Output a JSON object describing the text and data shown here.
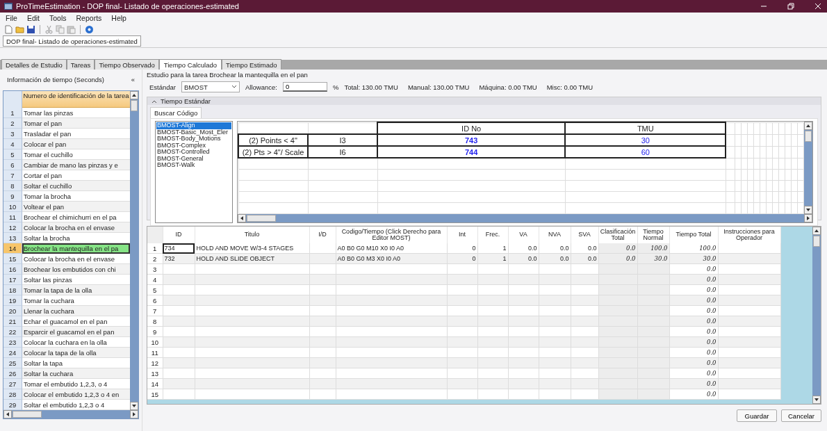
{
  "window": {
    "title": "ProTimeEstimation - DOP final- Listado de operaciones-estimated"
  },
  "menu": [
    "File",
    "Edit",
    "Tools",
    "Reports",
    "Help"
  ],
  "document_tab": {
    "label": "DOP final- Listado de operaciones-estimated",
    "selected": true
  },
  "tabs": [
    {
      "label": "Detalles de Estudio",
      "selected": false
    },
    {
      "label": "Tareas",
      "selected": false
    },
    {
      "label": "Tiempo Observado",
      "selected": false
    },
    {
      "label": "Tiempo Calculado",
      "selected": true
    },
    {
      "label": "Tiempo Estimado",
      "selected": false
    }
  ],
  "left_panel": {
    "title": "Información de tiempo (Seconds)",
    "collapse": "«",
    "header": "Numero de identificación de la tarea",
    "rows": [
      {
        "number": "1",
        "text": "Tomar las pinzas",
        "selected": false
      },
      {
        "number": "2",
        "text": "Tomar el pan",
        "selected": false
      },
      {
        "number": "3",
        "text": "Trasladar el pan",
        "selected": false
      },
      {
        "number": "4",
        "text": "Colocar el pan",
        "selected": false
      },
      {
        "number": "5",
        "text": "Tomar el cuchillo",
        "selected": false
      },
      {
        "number": "6",
        "text": "Cambiar de mano las pinzas y e",
        "selected": false
      },
      {
        "number": "7",
        "text": "Cortar el pan",
        "selected": false
      },
      {
        "number": "8",
        "text": "Soltar el cuchillo",
        "selected": false
      },
      {
        "number": "9",
        "text": "Tomar la brocha",
        "selected": false
      },
      {
        "number": "10",
        "text": "Voltear el pan",
        "selected": false
      },
      {
        "number": "11",
        "text": "Brochear el chimichurri en el pa",
        "selected": false
      },
      {
        "number": "12",
        "text": "Colocar la brocha en el envase",
        "selected": false
      },
      {
        "number": "13",
        "text": "Soltar la brocha",
        "selected": false
      },
      {
        "number": "14",
        "text": "Brochear la mantequilla en el pa",
        "selected": true
      },
      {
        "number": "15",
        "text": "Colocar la brocha en el envase",
        "selected": false
      },
      {
        "number": "16",
        "text": "Brochear los embutidos con chi",
        "selected": false
      },
      {
        "number": "17",
        "text": "Soltar las pinzas",
        "selected": false
      },
      {
        "number": "18",
        "text": "Tomar la tapa de la olla",
        "selected": false
      },
      {
        "number": "19",
        "text": "Tomar la cuchara",
        "selected": false
      },
      {
        "number": "20",
        "text": "Llenar la cuchara",
        "selected": false
      },
      {
        "number": "21",
        "text": "Echar el guacamol en el pan",
        "selected": false
      },
      {
        "number": "22",
        "text": "Esparcir el guacamol en el pan",
        "selected": false
      },
      {
        "number": "23",
        "text": "Colocar la cuchara en la olla",
        "selected": false
      },
      {
        "number": "24",
        "text": "Colocar la tapa de la olla",
        "selected": false
      },
      {
        "number": "25",
        "text": "Soltar la tapa",
        "selected": false
      },
      {
        "number": "26",
        "text": "Soltar la cuchara",
        "selected": false
      },
      {
        "number": "27",
        "text": "Tomar el embutido 1,2,3, o 4",
        "selected": false
      },
      {
        "number": "28",
        "text": "Colocar el embutido 1,2,3 o 4 en",
        "selected": false
      },
      {
        "number": "29",
        "text": "Soltar el embutido 1,2,3 o 4",
        "selected": false
      }
    ]
  },
  "study": {
    "title": "Estudio para la tarea Brochear la mantequilla en el pan",
    "standard_label": "Estándar",
    "standard_value": "BMOST",
    "allowance_label": "Allowance:",
    "allowance_value": "0",
    "percent": "%",
    "totals": [
      "Total: 130.00 TMU",
      "Manual: 130.00 TMU",
      "Máquina: 0.00 TMU",
      "Misc: 0.00 TMU"
    ]
  },
  "tiempo_estandar": {
    "title": "Tiempo Estándar",
    "expanded": true,
    "tabs": [
      {
        "label": "Buscar Código",
        "selected": true
      }
    ],
    "list": [
      {
        "label": "BMOST-Align",
        "selected": true
      },
      {
        "label": "BMOST-Basic_Most_Eler",
        "selected": false
      },
      {
        "label": "BMOST-Body_Motions",
        "selected": false
      },
      {
        "label": "BMOST-Complex",
        "selected": false
      },
      {
        "label": "BMOST-Controlled",
        "selected": false
      },
      {
        "label": "BMOST-General",
        "selected": false
      },
      {
        "label": "BMOST-Walk",
        "selected": false
      }
    ],
    "code_table": {
      "rows": [
        [
          "",
          "",
          "ID No",
          "TMU"
        ],
        [
          "(2) Points < 4\"",
          "I3",
          "743",
          "30"
        ],
        [
          "(2) Pts > 4\"/ Scale",
          "I6",
          "744",
          "60"
        ]
      ]
    }
  },
  "operations": {
    "columns": [
      {
        "label": "ID",
        "kind": "text"
      },
      {
        "label": "Titulo",
        "kind": "text"
      },
      {
        "label": "I/D",
        "kind": "text"
      },
      {
        "label": "Codigo/Tiempo (Click Derecho para Editor MOST)",
        "kind": "text"
      },
      {
        "label": "Int",
        "kind": "number"
      },
      {
        "label": "Frec.",
        "kind": "number"
      },
      {
        "label": "VA",
        "kind": "number"
      },
      {
        "label": "NVA",
        "kind": "number"
      },
      {
        "label": "SVA",
        "kind": "number"
      },
      {
        "label": "Clasificación Total",
        "kind": "computed"
      },
      {
        "label": "Tiempo Normal",
        "kind": "computed"
      },
      {
        "label": "Tiempo Total",
        "kind": "total"
      },
      {
        "label": "Instrucciones para Operador",
        "kind": "text"
      }
    ],
    "rows": [
      {
        "number": "1",
        "cells": [
          "734",
          "HOLD AND MOVE W/3-4 STAGES",
          "",
          "A0 B0 G0 M10 X0 I0 A0",
          "0",
          "1",
          "0.0",
          "0.0",
          "0.0",
          "0.0",
          "100.0",
          "100.0",
          ""
        ],
        "selected": true
      },
      {
        "number": "2",
        "cells": [
          "732",
          "HOLD AND SLIDE OBJECT",
          "",
          "A0 B0 G0 M3 X0 I0 A0",
          "0",
          "1",
          "0.0",
          "0.0",
          "0.0",
          "0.0",
          "30.0",
          "30.0",
          ""
        ],
        "selected": false
      },
      {
        "number": "3",
        "cells": [
          "",
          "",
          "",
          "",
          "",
          "",
          "",
          "",
          "",
          "",
          "",
          "0.0",
          ""
        ],
        "selected": false
      },
      {
        "number": "4",
        "cells": [
          "",
          "",
          "",
          "",
          "",
          "",
          "",
          "",
          "",
          "",
          "",
          "0.0",
          ""
        ],
        "selected": false
      },
      {
        "number": "5",
        "cells": [
          "",
          "",
          "",
          "",
          "",
          "",
          "",
          "",
          "",
          "",
          "",
          "0.0",
          ""
        ],
        "selected": false
      },
      {
        "number": "6",
        "cells": [
          "",
          "",
          "",
          "",
          "",
          "",
          "",
          "",
          "",
          "",
          "",
          "0.0",
          ""
        ],
        "selected": false
      },
      {
        "number": "7",
        "cells": [
          "",
          "",
          "",
          "",
          "",
          "",
          "",
          "",
          "",
          "",
          "",
          "0.0",
          ""
        ],
        "selected": false
      },
      {
        "number": "8",
        "cells": [
          "",
          "",
          "",
          "",
          "",
          "",
          "",
          "",
          "",
          "",
          "",
          "0.0",
          ""
        ],
        "selected": false
      },
      {
        "number": "9",
        "cells": [
          "",
          "",
          "",
          "",
          "",
          "",
          "",
          "",
          "",
          "",
          "",
          "0.0",
          ""
        ],
        "selected": false
      },
      {
        "number": "10",
        "cells": [
          "",
          "",
          "",
          "",
          "",
          "",
          "",
          "",
          "",
          "",
          "",
          "0.0",
          ""
        ],
        "selected": false
      },
      {
        "number": "11",
        "cells": [
          "",
          "",
          "",
          "",
          "",
          "",
          "",
          "",
          "",
          "",
          "",
          "0.0",
          ""
        ],
        "selected": false
      },
      {
        "number": "12",
        "cells": [
          "",
          "",
          "",
          "",
          "",
          "",
          "",
          "",
          "",
          "",
          "",
          "0.0",
          ""
        ],
        "selected": false
      },
      {
        "number": "13",
        "cells": [
          "",
          "",
          "",
          "",
          "",
          "",
          "",
          "",
          "",
          "",
          "",
          "0.0",
          ""
        ],
        "selected": false
      },
      {
        "number": "14",
        "cells": [
          "",
          "",
          "",
          "",
          "",
          "",
          "",
          "",
          "",
          "",
          "",
          "0.0",
          ""
        ],
        "selected": false
      },
      {
        "number": "15",
        "cells": [
          "",
          "",
          "",
          "",
          "",
          "",
          "",
          "",
          "",
          "",
          "",
          "0.0",
          ""
        ],
        "selected": false
      }
    ]
  },
  "buttons": [
    "Guardar",
    "Cancelar"
  ]
}
